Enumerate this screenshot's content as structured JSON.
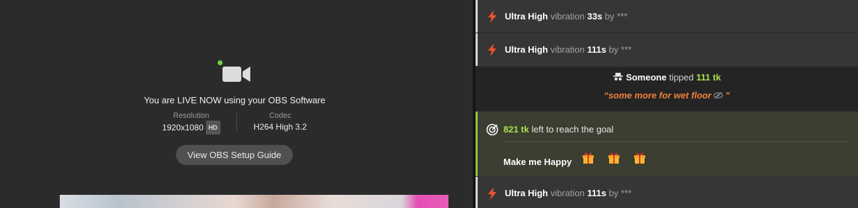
{
  "broadcast": {
    "status_text": "You are LIVE NOW using your OBS Software",
    "resolution_label": "Resolution",
    "resolution_value": "1920x1080",
    "resolution_badge": "HD",
    "codec_label": "Codec",
    "codec_value": "H264 High 3.2",
    "guide_button": "View OBS Setup Guide",
    "icons": {
      "camera": "video-camera-icon",
      "live": "live-dot-icon"
    },
    "colors": {
      "live_dot": "#6bd64e"
    }
  },
  "chat": {
    "events": [
      {
        "level": "Ultra High",
        "type": "vibration",
        "duration": "33s",
        "by": "by",
        "user": "***"
      },
      {
        "level": "Ultra High",
        "type": "vibration",
        "duration": "111s",
        "by": "by",
        "user": "***"
      }
    ],
    "tip": {
      "user": "Someone",
      "verb": "tipped",
      "amount": "111 tk",
      "message": "“some more for wet floor",
      "message_end": "”",
      "icons": [
        "anonymous-spy-icon",
        "hidden-eye-icon"
      ]
    },
    "goal": {
      "amount": "821 tk",
      "text": "left to reach the goal",
      "title": "Make me Happy",
      "icons": [
        "target-icon",
        "gift-icon"
      ]
    },
    "last_event": {
      "level": "Ultra High",
      "type": "vibration",
      "duration": "111s",
      "by": "by",
      "user": "***"
    },
    "colors": {
      "bolt": "#f0522d",
      "token": "#a8e04f",
      "message": "#f2803a",
      "goal_accent": "#8ccd3e"
    }
  }
}
